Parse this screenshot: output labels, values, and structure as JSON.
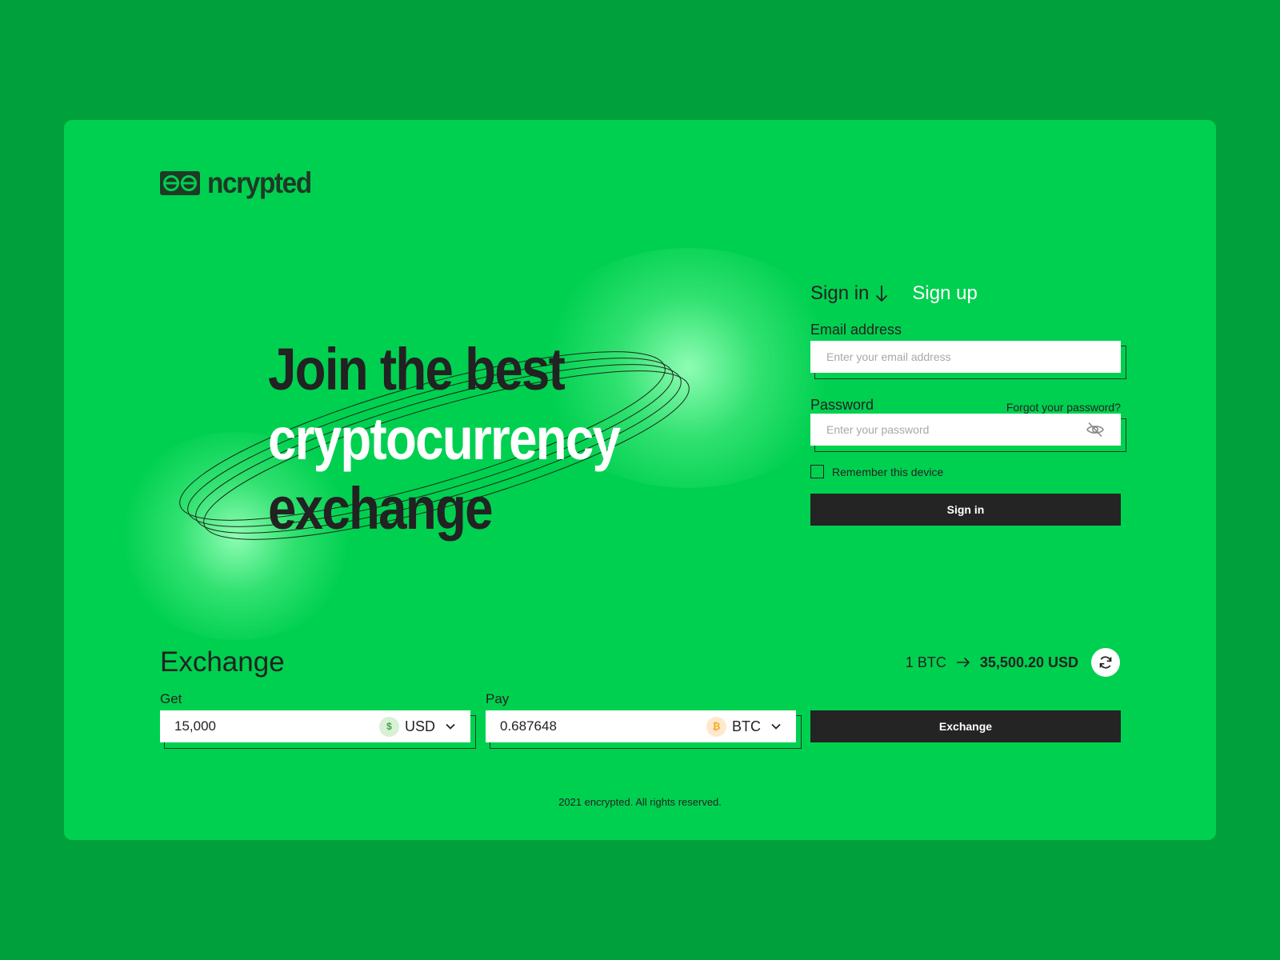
{
  "brand": {
    "name": "ncrypted",
    "logo_icon": "double-e-logo-icon"
  },
  "hero": {
    "line1": "Join the best",
    "line2": "cryptocurrency",
    "line3": "exchange"
  },
  "auth": {
    "tabs": [
      {
        "label": "Sign in",
        "active": true,
        "icon": "arrow-down-icon"
      },
      {
        "label": "Sign up",
        "active": false
      }
    ],
    "email": {
      "label": "Email address",
      "placeholder": "Enter your email address",
      "value": ""
    },
    "password": {
      "label": "Password",
      "placeholder": "Enter your password",
      "value": "",
      "forgot_label": "Forgot your password?",
      "toggle_icon": "eye-off-icon"
    },
    "remember_label": "Remember this device",
    "remember_checked": false,
    "submit_label": "Sign in"
  },
  "exchange": {
    "title": "Exchange",
    "rate": {
      "from": "1 BTC",
      "to": "35,500.20 USD",
      "arrow_icon": "arrow-right-icon",
      "refresh_icon": "refresh-icon"
    },
    "get": {
      "label": "Get",
      "value": "15,000",
      "currency": "USD",
      "coin_icon": "dollar-coin-icon",
      "coin_symbol": "$"
    },
    "pay": {
      "label": "Pay",
      "value": "0.687648",
      "currency": "BTC",
      "coin_icon": "bitcoin-coin-icon",
      "coin_symbol": "₿"
    },
    "submit_label": "Exchange"
  },
  "footer": {
    "text": "2021 encrypted. All rights reserved."
  },
  "colors": {
    "page_bg": "#00a03c",
    "card_bg": "#00d050",
    "dark": "#222222",
    "button_dark": "#242424",
    "logo": "#1e3a26",
    "white": "#ffffff"
  }
}
